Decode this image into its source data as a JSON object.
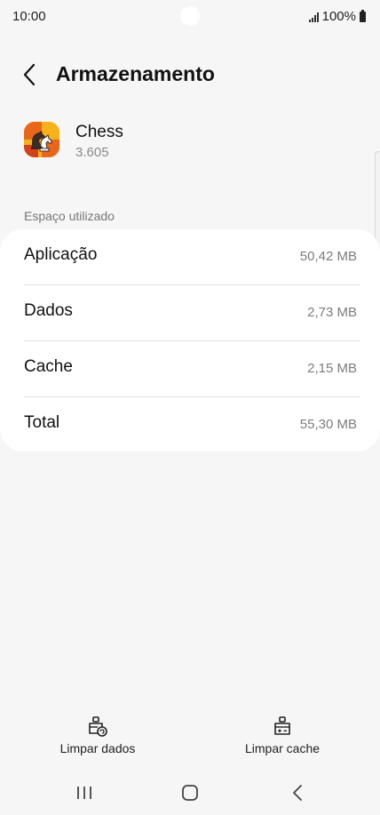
{
  "status_bar": {
    "time": "10:00",
    "battery": "100%",
    "icons": [
      "signal-icon",
      "battery-icon"
    ]
  },
  "header": {
    "back_icon": "back-arrow-icon",
    "title": "Armazenamento"
  },
  "app": {
    "name": "Chess",
    "version": "3.605",
    "icon": "chess-app-icon"
  },
  "storage": {
    "section_label": "Espaço utilizado",
    "rows": [
      {
        "label": "Aplicação",
        "value": "50,42 MB"
      },
      {
        "label": "Dados",
        "value": "2,73 MB"
      },
      {
        "label": "Cache",
        "value": "2,15 MB"
      },
      {
        "label": "Total",
        "value": "55,30 MB"
      }
    ]
  },
  "actions": {
    "clear_data": {
      "label": "Limpar dados",
      "icon": "clear-data-icon"
    },
    "clear_cache": {
      "label": "Limpar cache",
      "icon": "clear-cache-icon"
    }
  },
  "nav": {
    "icons": [
      "recents-icon",
      "home-icon",
      "back-icon"
    ]
  },
  "colors": {
    "background": "#f6f6f6",
    "card": "#ffffff",
    "app_icon": "#f7b21b",
    "secondary_text": "#7c7c7c"
  }
}
